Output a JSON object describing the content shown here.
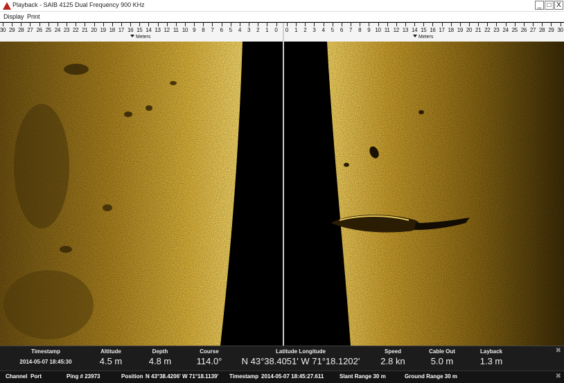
{
  "window": {
    "title": "Playback - SAIB 4125 Dual Frequency 900 KHz",
    "minimize": "_",
    "maximize": "□",
    "close": "X"
  },
  "menu": {
    "display": "Display",
    "print": "Print"
  },
  "ruler": {
    "units": "Meters",
    "port_labels": [
      "30",
      "29",
      "28",
      "27",
      "26",
      "25",
      "24",
      "23",
      "22",
      "21",
      "20",
      "19",
      "18",
      "17",
      "16",
      "15",
      "14",
      "13",
      "12",
      "11",
      "10",
      "9",
      "8",
      "7",
      "6",
      "5",
      "4",
      "3",
      "2",
      "1",
      "0"
    ],
    "starboard_labels": [
      "0",
      "1",
      "2",
      "3",
      "4",
      "5",
      "6",
      "7",
      "8",
      "9",
      "10",
      "11",
      "12",
      "13",
      "14",
      "15",
      "16",
      "17",
      "18",
      "19",
      "20",
      "21",
      "22",
      "23",
      "24",
      "25",
      "26",
      "27",
      "28",
      "29",
      "30"
    ]
  },
  "colors": {
    "sonar_bright": "#e8c24a",
    "sonar_mid": "#a67f1e",
    "sonar_dark": "#3a2a06",
    "water_column": "#000000"
  },
  "info": {
    "timestamp_label": "Timestamp",
    "timestamp": "2014-05-07 18:45:30",
    "altitude_label": "Altitude",
    "altitude": "4.5 m",
    "depth_label": "Depth",
    "depth": "4.8 m",
    "course_label": "Course",
    "course": "114.0°",
    "latlon_label": "Latitude Longitude",
    "latlon": "N 43°38.4051' W 71°18.1202'",
    "speed_label": "Speed",
    "speed": "2.8 kn",
    "cable_label": "Cable Out",
    "cable": "5.0 m",
    "layback_label": "Layback",
    "layback": "1.3 m",
    "close": "✖"
  },
  "status": {
    "channel_label": "Channel",
    "channel": "Port",
    "ping": "Ping # 23973",
    "position_label": "Position",
    "position": "N 43°38.4206' W 71°18.1139'",
    "timestamp_label": "Timestamp",
    "timestamp": "2014-05-07 18:45:27.611",
    "slant": "Slant Range 30 m",
    "ground": "Ground Range 30 m",
    "close": "✖"
  }
}
